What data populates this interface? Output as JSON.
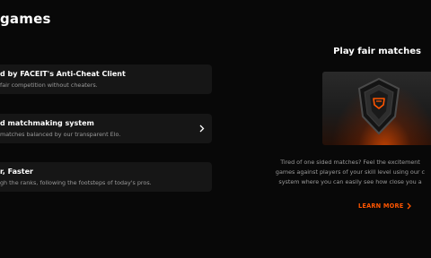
{
  "section": {
    "heading": "games"
  },
  "features": [
    {
      "title": "d by FACEIT's Anti-Cheat Client",
      "desc": "fair competition without cheaters."
    },
    {
      "title": "d matchmaking system",
      "desc": "matches balanced by our transparent Elo."
    },
    {
      "title": "r, Faster",
      "desc": "gh the ranks, following the footsteps of today's pros."
    }
  ],
  "promo": {
    "title": "Play fair matches",
    "text_lines": [
      "Tired of one sided matches? Feel the excitement",
      "games against players of your skill level using our c",
      "system where you can easily see how close you a"
    ],
    "cta": "LEARN MORE"
  },
  "colors": {
    "accent": "#ff5500",
    "card": "#161616",
    "background": "#080808"
  }
}
